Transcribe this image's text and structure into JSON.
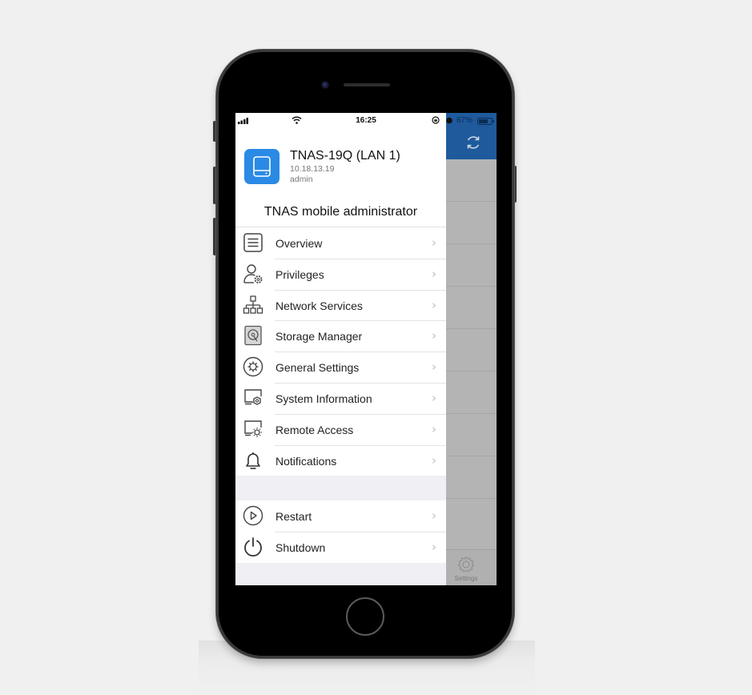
{
  "status_bar": {
    "time": "16:25",
    "battery": "67%",
    "icons": [
      "signal-icon",
      "wifi-icon",
      "orientation-lock-icon",
      "alarm-icon",
      "battery-icon"
    ]
  },
  "device": {
    "name": "TNAS-19Q (LAN 1)",
    "ip": "10.18.13.19",
    "user": "admin",
    "icon": "drive-icon"
  },
  "drawer": {
    "title": "TNAS mobile administrator",
    "menu": [
      {
        "label": "Overview",
        "icon": "list-icon"
      },
      {
        "label": "Privileges",
        "icon": "user-gear-icon"
      },
      {
        "label": "Network Services",
        "icon": "network-icon"
      },
      {
        "label": "Storage Manager",
        "icon": "hard-disk-icon"
      },
      {
        "label": "General Settings",
        "icon": "gear-circle-icon"
      },
      {
        "label": "System Information",
        "icon": "monitor-gear-icon"
      },
      {
        "label": "Remote Access",
        "icon": "monitor-sun-icon"
      },
      {
        "label": "Notifications",
        "icon": "bell-icon"
      }
    ],
    "power_menu": [
      {
        "label": "Restart",
        "icon": "play-circle-icon"
      },
      {
        "label": "Shutdown",
        "icon": "power-icon"
      }
    ],
    "chevron": "›"
  },
  "background_app": {
    "header_color": "#1f5a9c",
    "refresh_icon": "refresh-icon",
    "tab_settings_label": "Settings"
  },
  "colors": {
    "accent": "#2b8ae6"
  }
}
